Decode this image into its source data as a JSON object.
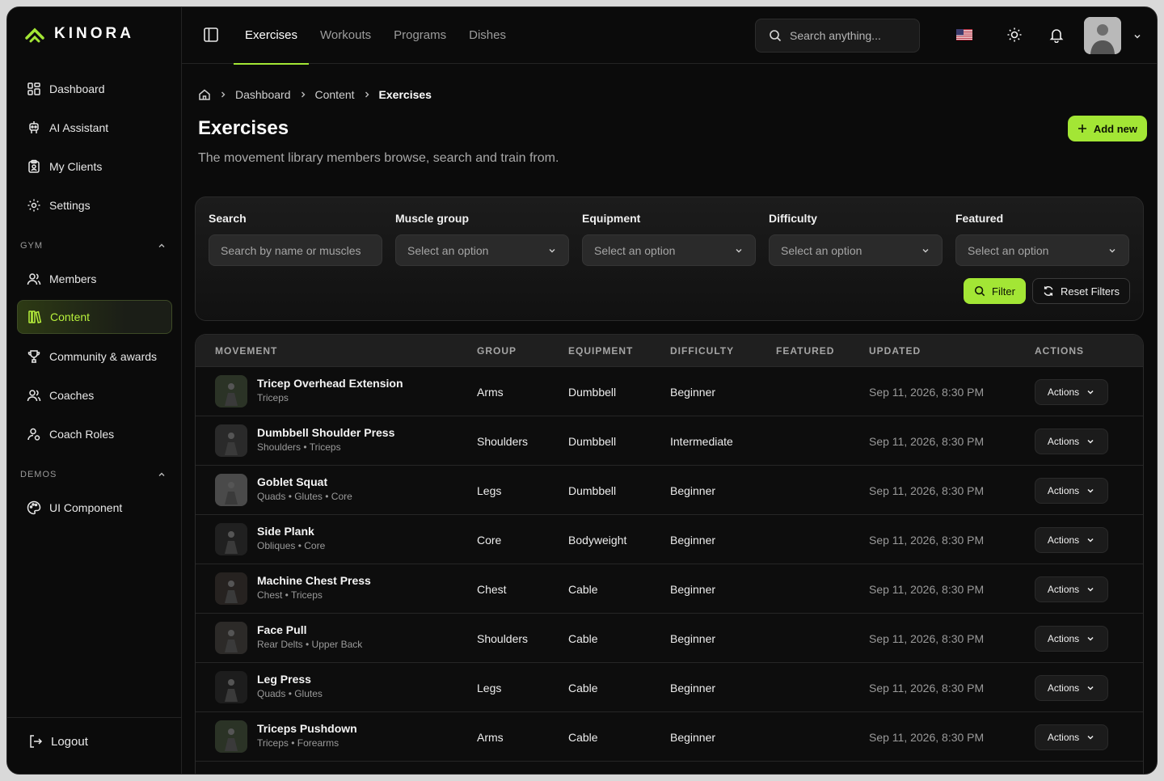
{
  "app": {
    "name": "KINORA",
    "accent": "#a3e635"
  },
  "sidebar": {
    "items": [
      {
        "label": "Dashboard",
        "icon": "dashboard-icon"
      },
      {
        "label": "AI Assistant",
        "icon": "robot-icon"
      },
      {
        "label": "My Clients",
        "icon": "clipboard-icon"
      },
      {
        "label": "Settings",
        "icon": "gear-icon"
      }
    ],
    "section_gym": "GYM",
    "gym_items": [
      {
        "label": "Members",
        "icon": "users-icon"
      },
      {
        "label": "Content",
        "icon": "library-icon",
        "active": true
      },
      {
        "label": "Community & awards",
        "icon": "trophy-icon"
      },
      {
        "label": "Coaches",
        "icon": "users-icon"
      },
      {
        "label": "Coach Roles",
        "icon": "user-role-icon"
      }
    ],
    "section_demos": "DEMOS",
    "demo_items": [
      {
        "label": "UI Component",
        "icon": "palette-icon"
      }
    ],
    "logout": "Logout"
  },
  "topbar": {
    "tabs": [
      "Exercises",
      "Workouts",
      "Programs",
      "Dishes"
    ],
    "active_tab": "Exercises",
    "search_placeholder": "Search anything..."
  },
  "breadcrumb": [
    "Dashboard",
    "Content",
    "Exercises"
  ],
  "page": {
    "title": "Exercises",
    "subtitle": "The movement library members browse, search and train from.",
    "add_label": "Add new"
  },
  "filters": {
    "search_label": "Search",
    "search_placeholder": "Search by name or muscles",
    "muscle_label": "Muscle group",
    "equipment_label": "Equipment",
    "difficulty_label": "Difficulty",
    "featured_label": "Featured",
    "select_placeholder": "Select an option",
    "filter_label": "Filter",
    "reset_label": "Reset Filters"
  },
  "table": {
    "columns": [
      "MOVEMENT",
      "GROUP",
      "EQUIPMENT",
      "DIFFICULTY",
      "FEATURED",
      "UPDATED",
      "ACTIONS"
    ],
    "action_label": "Actions",
    "rows": [
      {
        "name": "Tricep Overhead Extension",
        "muscles": "Triceps",
        "group": "Arms",
        "equipment": "Dumbbell",
        "difficulty": "Beginner",
        "updated": "Sep 11, 2026, 8:30 PM"
      },
      {
        "name": "Dumbbell Shoulder Press",
        "muscles": "Shoulders • Triceps",
        "group": "Shoulders",
        "equipment": "Dumbbell",
        "difficulty": "Intermediate",
        "updated": "Sep 11, 2026, 8:30 PM"
      },
      {
        "name": "Goblet Squat",
        "muscles": "Quads • Glutes • Core",
        "group": "Legs",
        "equipment": "Dumbbell",
        "difficulty": "Beginner",
        "updated": "Sep 11, 2026, 8:30 PM"
      },
      {
        "name": "Side Plank",
        "muscles": "Obliques • Core",
        "group": "Core",
        "equipment": "Bodyweight",
        "difficulty": "Beginner",
        "updated": "Sep 11, 2026, 8:30 PM"
      },
      {
        "name": "Machine Chest Press",
        "muscles": "Chest • Triceps",
        "group": "Chest",
        "equipment": "Cable",
        "difficulty": "Beginner",
        "updated": "Sep 11, 2026, 8:30 PM"
      },
      {
        "name": "Face Pull",
        "muscles": "Rear Delts • Upper Back",
        "group": "Shoulders",
        "equipment": "Cable",
        "difficulty": "Beginner",
        "updated": "Sep 11, 2026, 8:30 PM"
      },
      {
        "name": "Leg Press",
        "muscles": "Quads • Glutes",
        "group": "Legs",
        "equipment": "Cable",
        "difficulty": "Beginner",
        "updated": "Sep 11, 2026, 8:30 PM"
      },
      {
        "name": "Triceps Pushdown",
        "muscles": "Triceps • Forearms",
        "group": "Arms",
        "equipment": "Cable",
        "difficulty": "Beginner",
        "updated": "Sep 11, 2026, 8:30 PM"
      }
    ]
  }
}
